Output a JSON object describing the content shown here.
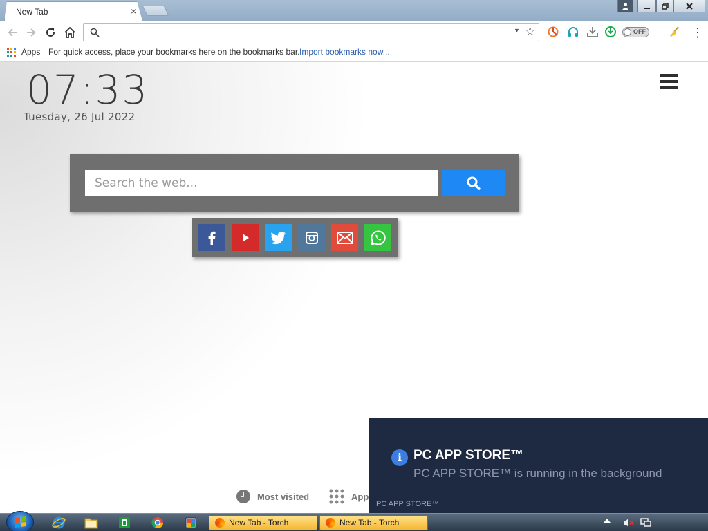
{
  "browser": {
    "tab_title": "New Tab",
    "tab_close": "×",
    "omnibox": {
      "value": "",
      "placeholder": ""
    },
    "toggle_label": "OFF",
    "bookmarks": {
      "apps_label": "Apps",
      "hint_text": "For quick access, place your bookmarks here on the bookmarks bar.",
      "import_link": "Import bookmarks now..."
    }
  },
  "page": {
    "clock": {
      "time": "07:33",
      "date": "Tuesday,  26 Jul  2022"
    },
    "search": {
      "placeholder": "Search the web..."
    },
    "social": [
      {
        "name": "facebook",
        "color": "#3b5998"
      },
      {
        "name": "youtube",
        "color": "#d42a2a"
      },
      {
        "name": "twitter",
        "color": "#2aa3ef"
      },
      {
        "name": "instagram",
        "color": "#51779b"
      },
      {
        "name": "email",
        "color": "#e14b3b"
      },
      {
        "name": "whatsapp",
        "color": "#35c540"
      }
    ],
    "bottom_links": {
      "most_visited": "Most visited",
      "apps": "Apps"
    }
  },
  "notification": {
    "title": "PC APP STORE™",
    "body": "PC APP STORE™ is running in the background",
    "footer": "PC APP STORE™"
  },
  "taskbar": {
    "tasks": [
      {
        "label": "New Tab - Torch"
      },
      {
        "label": "New Tab - Torch"
      }
    ]
  },
  "colors": {
    "search_button": "#1e88f5",
    "toast_bg": "#1e2942",
    "task_active": "#f7b733"
  }
}
